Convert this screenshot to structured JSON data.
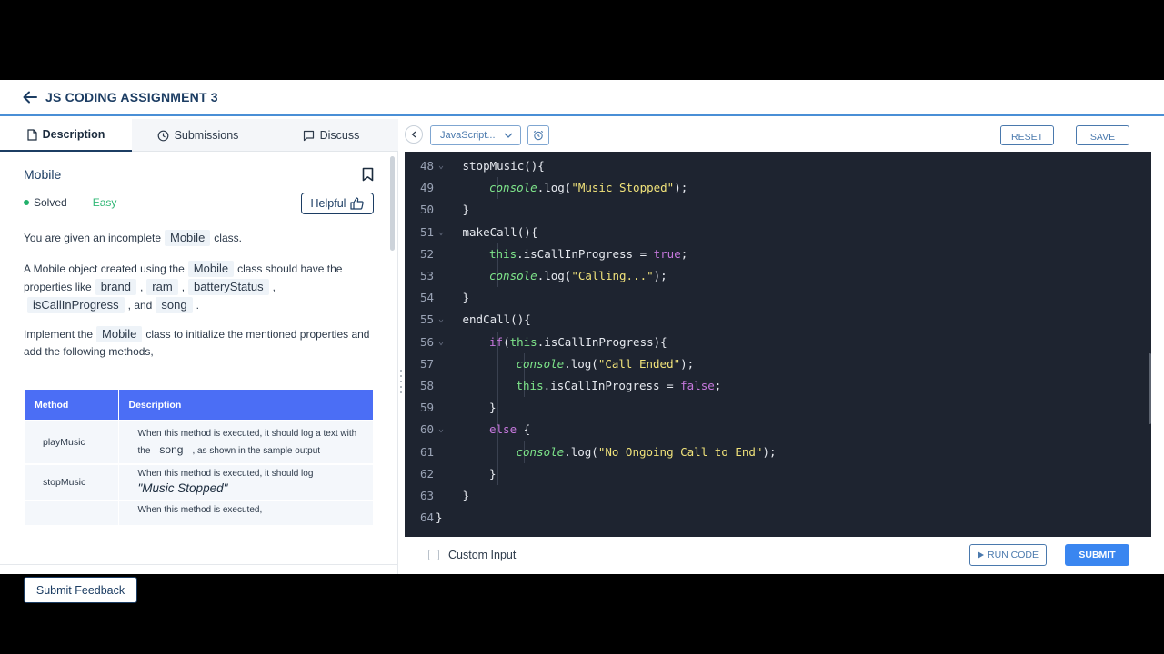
{
  "header": {
    "title": "JS CODING ASSIGNMENT 3"
  },
  "tabs": [
    {
      "label": "Description",
      "icon": "document-icon",
      "active": true
    },
    {
      "label": "Submissions",
      "icon": "clock-icon",
      "active": false
    },
    {
      "label": "Discuss",
      "icon": "chat-icon",
      "active": false
    }
  ],
  "problem": {
    "title": "Mobile",
    "status": "Solved",
    "difficulty": "Easy",
    "helpful_label": "Helpful",
    "p1": {
      "pre": "You are given an incomplete",
      "chip": "Mobile",
      "post": "class."
    },
    "p2": {
      "pre": "A Mobile object created using the",
      "chip1": "Mobile",
      "mid": "class should have the properties like",
      "chip2": "brand",
      "sep1": ",",
      "chip3": "ram",
      "sep2": ",",
      "chip4": "batteryStatus",
      "sep3": ",",
      "chip5": "isCallInProgress",
      "and": ", and",
      "chip6": "song",
      "end": "."
    },
    "p3": {
      "pre": "Implement the",
      "chip": "Mobile",
      "post": "class to initialize the mentioned properties and add the following methods,"
    },
    "table": {
      "headers": [
        "Method",
        "Description"
      ],
      "rows": [
        {
          "method": "playMusic",
          "desc_pre": "When this method is executed, it should log a text with the",
          "desc_chip": "song",
          "desc_post": ", as shown in the sample output"
        },
        {
          "method": "stopMusic",
          "desc_pre": "When this method is executed, it should log",
          "desc_italic": "\"Music Stopped\""
        },
        {
          "method": "",
          "desc_pre": "When this method is executed,"
        }
      ]
    },
    "feedback_label": "Submit Feedback"
  },
  "editor": {
    "language": "JavaScript...",
    "reset_label": "RESET",
    "save_label": "SAVE",
    "lines": [
      {
        "n": "48",
        "indent": 1,
        "fold": true,
        "html": "stopMusic(){"
      },
      {
        "n": "49",
        "indent": 2,
        "fold": false,
        "html": "<span class=\"co\">console</span>.log(<span class=\"st\">\"Music Stopped\"</span>);"
      },
      {
        "n": "50",
        "indent": 1,
        "fold": false,
        "html": "}"
      },
      {
        "n": "51",
        "indent": 1,
        "fold": true,
        "html": "makeCall(){"
      },
      {
        "n": "52",
        "indent": 2,
        "fold": false,
        "html": "<span class=\"th\">this</span>.isCallInProgress = <span class=\"bo\">true</span>;"
      },
      {
        "n": "53",
        "indent": 2,
        "fold": false,
        "html": "<span class=\"co\">console</span>.log(<span class=\"st\">\"Calling...\"</span>);"
      },
      {
        "n": "54",
        "indent": 1,
        "fold": false,
        "html": "}"
      },
      {
        "n": "55",
        "indent": 1,
        "fold": true,
        "html": "endCall(){"
      },
      {
        "n": "56",
        "indent": 2,
        "fold": true,
        "html": "<span class=\"kw\">if</span>(<span class=\"th\">this</span>.isCallInProgress){"
      },
      {
        "n": "57",
        "indent": 3,
        "fold": false,
        "html": "<span class=\"co\">console</span>.log(<span class=\"st\">\"Call Ended\"</span>);"
      },
      {
        "n": "58",
        "indent": 3,
        "fold": false,
        "html": "<span class=\"th\">this</span>.isCallInProgress = <span class=\"bo\">false</span>;"
      },
      {
        "n": "59",
        "indent": 2,
        "fold": false,
        "html": "}"
      },
      {
        "n": "60",
        "indent": 2,
        "fold": true,
        "html": "<span class=\"kw\">else</span> {"
      },
      {
        "n": "61",
        "indent": 3,
        "fold": false,
        "html": "<span class=\"co\">console</span>.log(<span class=\"st\">\"No Ongoing Call to End\"</span>);"
      },
      {
        "n": "62",
        "indent": 2,
        "fold": false,
        "html": "}"
      },
      {
        "n": "63",
        "indent": 1,
        "fold": false,
        "html": "}"
      },
      {
        "n": "64",
        "indent": 0,
        "fold": false,
        "html": "}"
      }
    ],
    "custom_input_label": "Custom Input",
    "run_label": "RUN CODE",
    "submit_label": "SUBMIT"
  },
  "colors": {
    "accent": "#3a86f0",
    "header_text": "#1c3d63",
    "table_header": "#4b6ef5",
    "editor_bg": "#1e2430",
    "solved": "#22b06b",
    "easy": "#32b877"
  }
}
